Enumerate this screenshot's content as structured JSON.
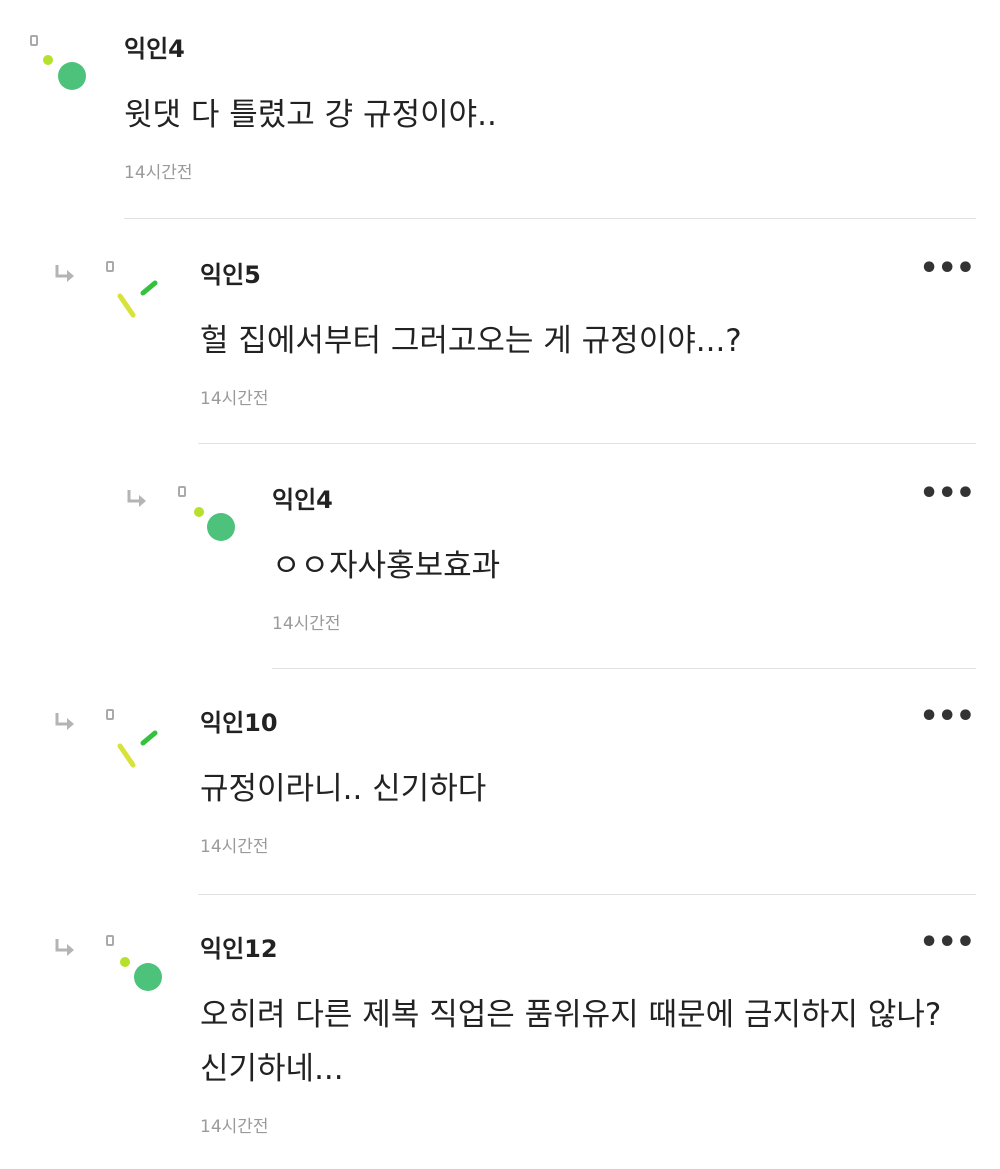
{
  "comments": [
    {
      "author": "익인4",
      "text": "윗댓 다 틀렸고 걍 규정이야..",
      "time": "14시간전",
      "avatar": "dot-circle-icon",
      "reply": false,
      "more": ""
    },
    {
      "author": "익인5",
      "text": "헐 집에서부터 그러고오는 게 규정이야...?",
      "time": "14시간전",
      "avatar": "slash-lines-icon",
      "reply": true,
      "more": "•••"
    },
    {
      "author": "익인4",
      "text": "ㅇㅇ자사홍보효과",
      "time": "14시간전",
      "avatar": "dot-circle-icon",
      "reply": true,
      "more": "•••"
    },
    {
      "author": "익인10",
      "text": "규정이라니.. 신기하다",
      "time": "14시간전",
      "avatar": "slash-lines-icon",
      "reply": true,
      "more": "•••"
    },
    {
      "author": "익인12",
      "text": "오히려 다른 제복 직업은 품위유지 때문에 금지하지 않나? 신기하네...",
      "time": "14시간전",
      "avatar": "dot-circle-icon",
      "reply": true,
      "more": "•••"
    }
  ],
  "colors": {
    "green": "#4cc27a",
    "lime": "#b5e02b",
    "yellow_green": "#d7e23a",
    "arrow_gray": "#b4b4b4"
  }
}
